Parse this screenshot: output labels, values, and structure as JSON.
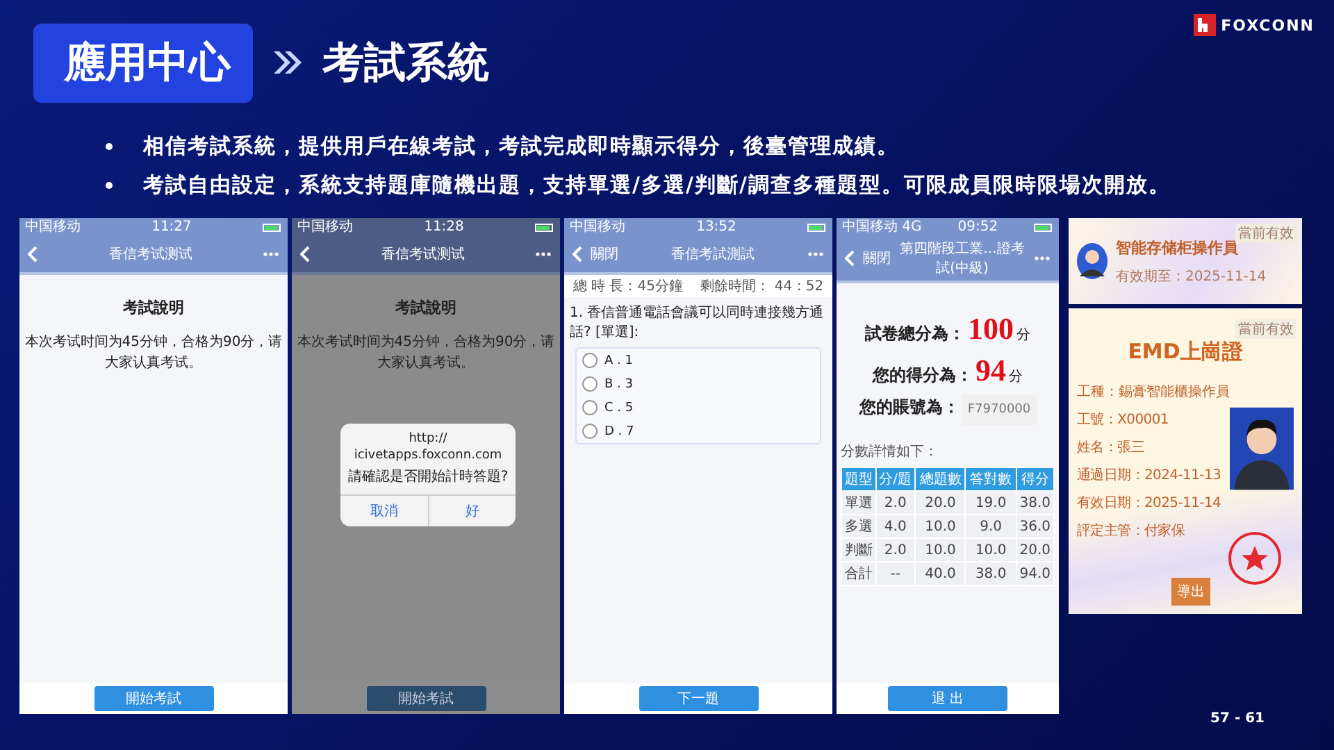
{
  "header": {
    "section": "應用中心",
    "title": "考試系統"
  },
  "logo": {
    "text": "FOXCONN"
  },
  "bullets": [
    "相信考試系統，提供用戶在線考試，考試完成即時顯示得分，後臺管理成績。",
    "考試自由設定，系統支持題庫隨機出題，支持單選/多選/判斷/調查多種題型。可限成員限時限場次開放。"
  ],
  "screens": [
    {
      "kind": "intro",
      "dimmed": false,
      "status": {
        "carrier": "中国移动",
        "time": "11:27"
      },
      "nav": {
        "title": "香信考试测试"
      },
      "heading": "考試說明",
      "body": "本次考试时间为45分钟，合格为90分，请大家认真考试。",
      "button": "開始考試"
    },
    {
      "kind": "intro",
      "dimmed": true,
      "status": {
        "carrier": "中国移动",
        "time": "11:28"
      },
      "nav": {
        "title": "香信考试测试"
      },
      "heading": "考試說明",
      "body": "本次考试时间为45分钟，合格为90分，请大家认真考试。",
      "button": "開始考試",
      "dialog": {
        "title": "http://\nicivetapps.foxconn.com",
        "message": "請確認是否開始計時答題?",
        "buttons": [
          "取消",
          "好"
        ]
      }
    },
    {
      "kind": "question",
      "dimmed": false,
      "status": {
        "carrier": "中国移动",
        "time": "13:52"
      },
      "nav": {
        "close": "關閉",
        "title": "香信考試測試"
      },
      "timer": {
        "total": "總 時 長：45分鐘",
        "remaining": "剩餘時間： 44 : 52"
      },
      "question": "1. 香信普通電話會議可以同時連接幾方通話? [單選]:",
      "options": [
        {
          "label": "A . 1",
          "selected": false
        },
        {
          "label": "B . 3",
          "selected": false
        },
        {
          "label": "C . 5",
          "selected": false
        },
        {
          "label": "D . 7",
          "selected": false
        }
      ],
      "button": "下一題"
    },
    {
      "kind": "result",
      "dimmed": false,
      "status": {
        "carrier": "中国移动 4G",
        "time": "09:52"
      },
      "nav": {
        "close": "關閉",
        "title": "第四階段工業...證考試(中級)"
      },
      "scores": [
        {
          "label": "試卷總分為：",
          "value": "100",
          "unit": "分"
        },
        {
          "label": "您的得分為：",
          "value": "94",
          "unit": "分"
        }
      ],
      "account": {
        "label": "您的賬號為：",
        "value": "F7970000"
      },
      "details_caption": "分數詳情如下：",
      "table": {
        "columns": [
          "題型",
          "分/題",
          "總題數",
          "答對數",
          "得分"
        ],
        "rows": [
          [
            "單選",
            "2.0",
            "20.0",
            "19.0",
            "38.0"
          ],
          [
            "多選",
            "4.0",
            "10.0",
            "9.0",
            "36.0"
          ],
          [
            "判斷",
            "2.0",
            "10.0",
            "10.0",
            "20.0"
          ],
          [
            "合計",
            "--",
            "40.0",
            "38.0",
            "94.0"
          ]
        ]
      },
      "button": "退 出"
    }
  ],
  "certificate": {
    "summary": {
      "title": "智能存储柜操作員",
      "valid_until": "有效期至：2025-11-14",
      "badge": "當前有效"
    },
    "card": {
      "badge": "當前有效",
      "title": "EMD上崗證",
      "job": "工種：錫膏智能櫃操作員",
      "fields": [
        "工號：X00001",
        "姓名：張三",
        "通過日期：2024-11-13",
        "有效日期：2025-11-14",
        "評定主管：付家保"
      ],
      "button": "導出"
    }
  },
  "page_number": "57 - 61"
}
